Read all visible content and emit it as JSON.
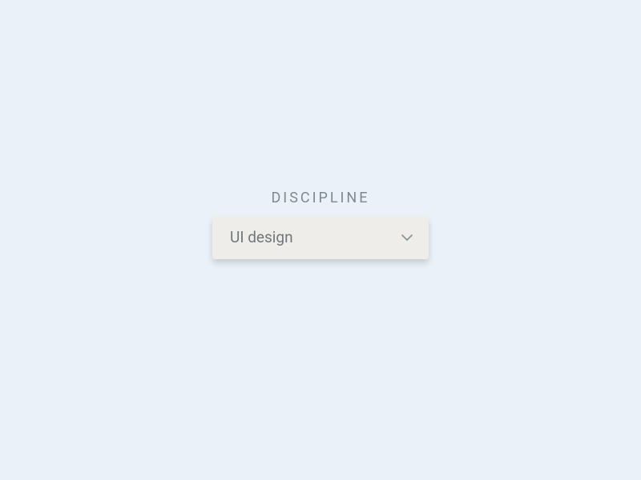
{
  "form": {
    "label": "DISCIPLINE",
    "dropdown": {
      "selected": "UI design"
    }
  }
}
